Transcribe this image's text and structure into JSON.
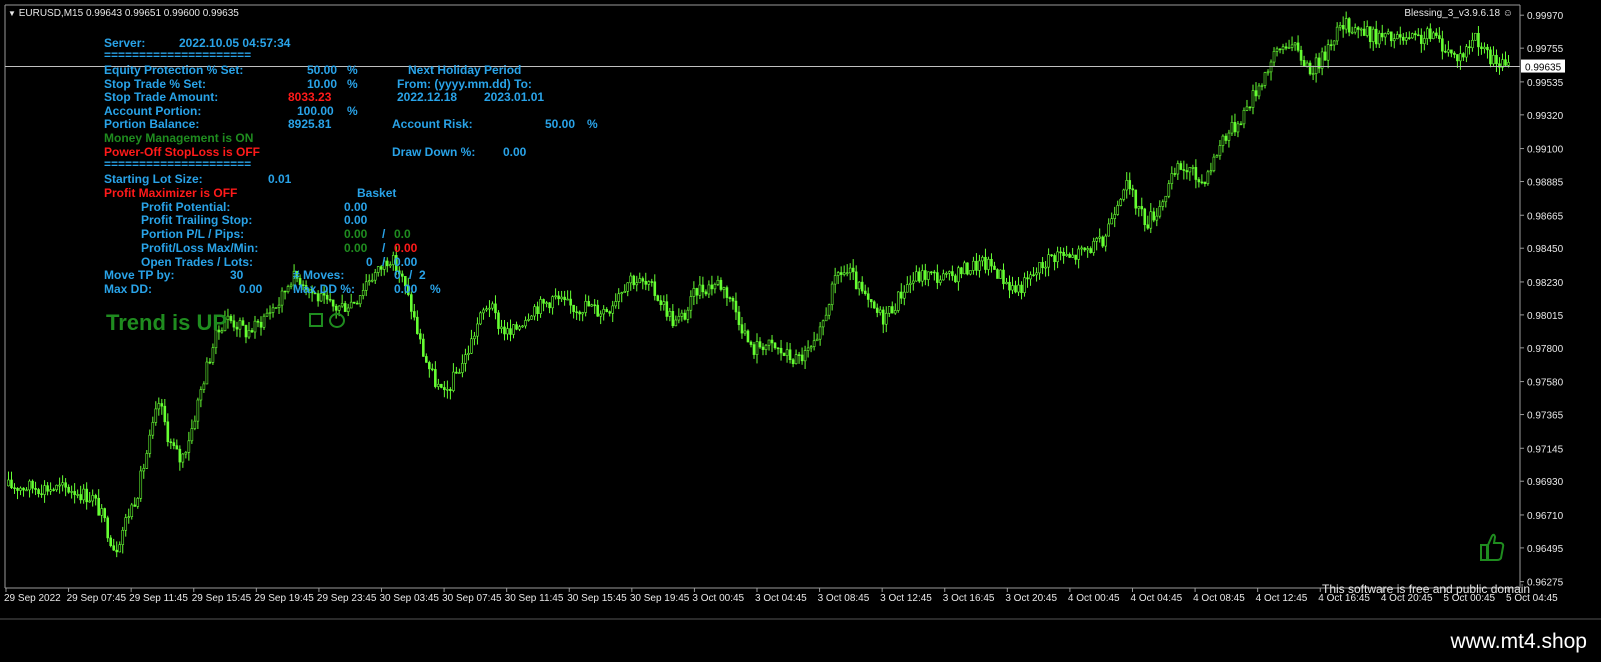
{
  "header": {
    "symbol_info": "EURUSD,M15  0.99643 0.99651 0.99600 0.99635",
    "indicator": "Blessing_3_v3.9.6.18"
  },
  "panel": {
    "server_label": "Server:",
    "server_time": "2022.10.05 04:57:34",
    "sep1": "=====================",
    "equity_label": "Equity Protection % Set:",
    "equity_value": "50.00",
    "equity_unit": "%",
    "holiday_label": "Next Holiday Period",
    "stoptrade_label": "Stop Trade % Set:",
    "stoptrade_value": "10.00",
    "stoptrade_unit": "%",
    "from_label": "From: (yyyy.mm.dd) To:",
    "stopamount_label": "Stop Trade Amount:",
    "stopamount_value": "8033.23",
    "holiday_from": "2022.12.18",
    "holiday_to": "2023.01.01",
    "portion_label": "Account Portion:",
    "portion_value": "100.00",
    "portion_unit": "%",
    "balance_label": "Portion Balance:",
    "balance_value": "8925.81",
    "risk_label": "Account Risk:",
    "risk_value": "50.00",
    "risk_unit": "%",
    "mm_status": "Money Management is ON",
    "poweroff_status": "Power-Off StopLoss is OFF",
    "drawdown_label": "Draw Down %:",
    "drawdown_value": "0.00",
    "sep2": "=====================",
    "lot_label": "Starting Lot Size:",
    "lot_value": "0.01",
    "maximizer_status": "Profit Maximizer is OFF",
    "basket_label": "Basket",
    "potential_label": "Profit Potential:",
    "potential_value": "0.00",
    "trailing_label": "Profit Trailing Stop:",
    "trailing_value": "0.00",
    "pl_label": "Portion P/L / Pips:",
    "pl_value": "0.00",
    "pl_slash": "/",
    "pips_value": "0.0",
    "plmax_label": "Profit/Loss Max/Min:",
    "plmax_value": "0.00",
    "plmax_slash": "/",
    "plmin_value": "0.00",
    "open_label": "Open Trades / Lots:",
    "open_trades": "0",
    "open_slash": "/",
    "open_lots": "0.00",
    "movetp_label": "Move TP by:",
    "movetp_value": "30",
    "moves_label": "# Moves:",
    "moves_value": "0",
    "moves_slash": "/",
    "moves_max": "2",
    "maxdd_label": "Max DD:",
    "maxdd_value": "0.00",
    "maxddp_label": "Max DD %:",
    "maxddp_value": "0.00",
    "maxddp_unit": "%"
  },
  "trend_text": "Trend is UP",
  "free_text": "This software is free and public domain",
  "site_url": "www.mt4.shop",
  "colors": {
    "background": "#000000",
    "bull_candle": "#66FF33",
    "text_blue": "#29A3E8",
    "text_red": "#FF1A1A",
    "text_green": "#1F8C1F",
    "bid_line": "#C0C0C0"
  },
  "icons": {
    "smiley": "smiley-icon",
    "square": "square-icon",
    "circle": "circle-icon",
    "thumbs_up": "thumbs-up-icon"
  },
  "chart_data": {
    "type": "candlestick",
    "symbol": "EURUSD",
    "timeframe": "M15",
    "ohlc": {
      "open": 0.99643,
      "high": 0.99651,
      "low": 0.996,
      "close": 0.99635
    },
    "current_price": "0.99635",
    "ylim": [
      0.9624,
      1.0003
    ],
    "price_ticks": [
      "0.99970",
      "0.99755",
      "0.99535",
      "0.99320",
      "0.99100",
      "0.98885",
      "0.98665",
      "0.98450",
      "0.98230",
      "0.98015",
      "0.97800",
      "0.97580",
      "0.97365",
      "0.97145",
      "0.96930",
      "0.96710",
      "0.96495",
      "0.96275"
    ],
    "time_ticks": [
      "29 Sep 2022",
      "29 Sep 07:45",
      "29 Sep 11:45",
      "29 Sep 15:45",
      "29 Sep 19:45",
      "29 Sep 23:45",
      "30 Sep 03:45",
      "30 Sep 07:45",
      "30 Sep 11:45",
      "30 Sep 15:45",
      "30 Sep 19:45",
      "3 Oct 00:45",
      "3 Oct 04:45",
      "3 Oct 08:45",
      "3 Oct 12:45",
      "3 Oct 16:45",
      "3 Oct 20:45",
      "4 Oct 00:45",
      "4 Oct 04:45",
      "4 Oct 08:45",
      "4 Oct 12:45",
      "4 Oct 16:45",
      "4 Oct 20:45",
      "5 Oct 00:45",
      "5 Oct 04:45"
    ],
    "price_path": [
      [
        0,
        0.969
      ],
      [
        6,
        0.9688
      ],
      [
        8,
        0.9682
      ],
      [
        9,
        0.9667
      ],
      [
        10,
        0.9648
      ],
      [
        11,
        0.9668
      ],
      [
        12,
        0.9685
      ],
      [
        13,
        0.9715
      ],
      [
        14,
        0.9745
      ],
      [
        15,
        0.9718
      ],
      [
        16,
        0.9706
      ],
      [
        17,
        0.9728
      ],
      [
        18,
        0.9758
      ],
      [
        19,
        0.9784
      ],
      [
        20,
        0.98
      ],
      [
        21,
        0.9796
      ],
      [
        22,
        0.979
      ],
      [
        23,
        0.9795
      ],
      [
        24,
        0.9804
      ],
      [
        25,
        0.981
      ],
      [
        26,
        0.9826
      ],
      [
        27,
        0.9825
      ],
      [
        28,
        0.9816
      ],
      [
        29,
        0.981
      ],
      [
        30,
        0.9806
      ],
      [
        31,
        0.9808
      ],
      [
        32,
        0.9812
      ],
      [
        33,
        0.9825
      ],
      [
        34,
        0.983
      ],
      [
        35,
        0.984
      ],
      [
        36,
        0.9828
      ],
      [
        37,
        0.9806
      ],
      [
        38,
        0.9778
      ],
      [
        39,
        0.976
      ],
      [
        40,
        0.9748
      ],
      [
        41,
        0.9762
      ],
      [
        42,
        0.9775
      ],
      [
        43,
        0.9795
      ],
      [
        44,
        0.981
      ],
      [
        45,
        0.9795
      ],
      [
        46,
        0.9788
      ],
      [
        47,
        0.9797
      ],
      [
        48,
        0.9806
      ],
      [
        49,
        0.9808
      ],
      [
        50,
        0.9813
      ],
      [
        51,
        0.9808
      ],
      [
        52,
        0.9806
      ],
      [
        53,
        0.9808
      ],
      [
        54,
        0.9804
      ],
      [
        55,
        0.9806
      ],
      [
        56,
        0.9818
      ],
      [
        57,
        0.9826
      ],
      [
        58,
        0.9822
      ],
      [
        59,
        0.9818
      ],
      [
        60,
        0.9808
      ],
      [
        61,
        0.9796
      ],
      [
        62,
        0.9802
      ],
      [
        63,
        0.9818
      ],
      [
        64,
        0.982
      ],
      [
        65,
        0.9823
      ],
      [
        66,
        0.9814
      ],
      [
        67,
        0.9797
      ],
      [
        68,
        0.9778
      ],
      [
        69,
        0.9783
      ],
      [
        70,
        0.978
      ],
      [
        71,
        0.9776
      ],
      [
        72,
        0.9772
      ],
      [
        73,
        0.9776
      ],
      [
        74,
        0.9782
      ],
      [
        75,
        0.981
      ],
      [
        76,
        0.983
      ],
      [
        77,
        0.9828
      ],
      [
        78,
        0.9816
      ],
      [
        79,
        0.9805
      ],
      [
        80,
        0.98
      ],
      [
        81,
        0.9808
      ],
      [
        82,
        0.982
      ],
      [
        83,
        0.9826
      ],
      [
        84,
        0.9828
      ],
      [
        85,
        0.9826
      ],
      [
        86,
        0.9825
      ],
      [
        87,
        0.983
      ],
      [
        88,
        0.9833
      ],
      [
        89,
        0.9835
      ],
      [
        90,
        0.9833
      ],
      [
        91,
        0.9825
      ],
      [
        92,
        0.9818
      ],
      [
        93,
        0.9822
      ],
      [
        94,
        0.983
      ],
      [
        95,
        0.9838
      ],
      [
        96,
        0.9842
      ],
      [
        97,
        0.9838
      ],
      [
        98,
        0.9842
      ],
      [
        99,
        0.9846
      ],
      [
        100,
        0.9848
      ],
      [
        101,
        0.987
      ],
      [
        102,
        0.9888
      ],
      [
        103,
        0.9875
      ],
      [
        104,
        0.9862
      ],
      [
        105,
        0.987
      ],
      [
        106,
        0.9885
      ],
      [
        107,
        0.9898
      ],
      [
        108,
        0.9895
      ],
      [
        109,
        0.9888
      ],
      [
        110,
        0.99
      ],
      [
        111,
        0.9918
      ],
      [
        112,
        0.9924
      ],
      [
        113,
        0.9935
      ],
      [
        114,
        0.9948
      ],
      [
        115,
        0.9962
      ],
      [
        116,
        0.9974
      ],
      [
        117,
        0.998
      ],
      [
        118,
        0.997
      ],
      [
        119,
        0.9962
      ],
      [
        120,
        0.9968
      ],
      [
        121,
        0.9984
      ],
      [
        122,
        0.999
      ],
      [
        123,
        0.999
      ],
      [
        124,
        0.9985
      ],
      [
        125,
        0.9983
      ],
      [
        126,
        0.9982
      ],
      [
        127,
        0.9981
      ],
      [
        128,
        0.998
      ],
      [
        129,
        0.9982
      ],
      [
        130,
        0.9984
      ],
      [
        131,
        0.9978
      ],
      [
        132,
        0.997
      ],
      [
        133,
        0.9972
      ],
      [
        134,
        0.9985
      ],
      [
        135,
        0.997
      ],
      [
        136,
        0.9966
      ],
      [
        137,
        0.9963
      ]
    ]
  }
}
